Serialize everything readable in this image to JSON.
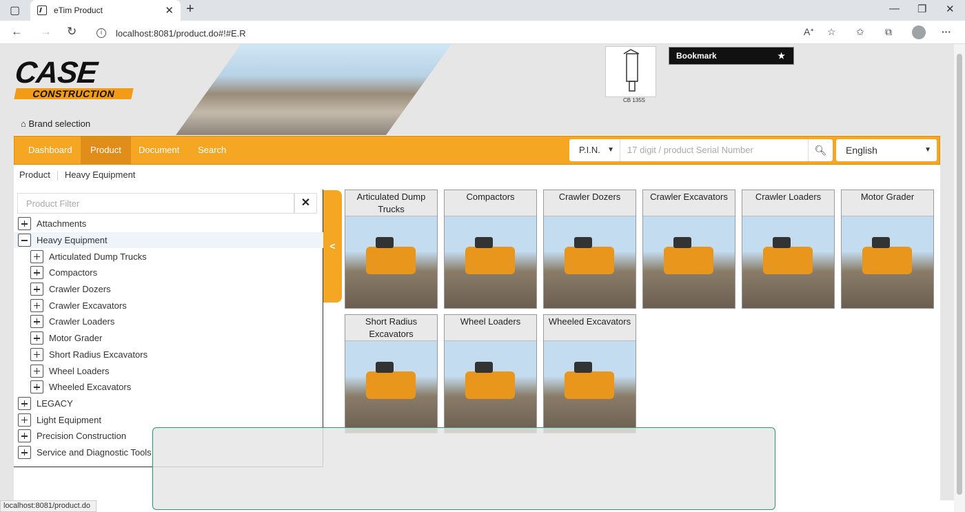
{
  "browser": {
    "tab_title": "eTim Product",
    "tab_close": "✕",
    "new_tab": "+",
    "url": "localhost:8081/product.do#!#E.R",
    "status_url": "localhost:8081/product.do",
    "icons": [
      "sidebar-toggle-icon",
      "back-icon",
      "forward-icon",
      "refresh-icon",
      "info-icon",
      "read-aloud-icon",
      "favorite-add-icon",
      "favorites-icon",
      "collections-icon",
      "profile-icon",
      "more-icon"
    ]
  },
  "header": {
    "brand_case": "CASE",
    "brand_construction": "CONSTRUCTION",
    "brand_selection": "Brand selection",
    "thumb_caption": "CB 135S",
    "bookmark": "Bookmark"
  },
  "nav": {
    "items": [
      "Dashboard",
      "Product",
      "Document",
      "Search"
    ],
    "active": "Product",
    "pin_label": "P.I.N.",
    "pin_placeholder": "17 digit / product Serial Number",
    "language": "English"
  },
  "breadcrumb": [
    "Product",
    "Heavy Equipment"
  ],
  "filter": {
    "placeholder": "Product Filter",
    "clear": "✕"
  },
  "tree": [
    {
      "label": "Attachments",
      "level": 0,
      "expanded": false
    },
    {
      "label": "Heavy Equipment",
      "level": 0,
      "expanded": true,
      "selected": true
    },
    {
      "label": "Articulated Dump Trucks",
      "level": 1,
      "expanded": false
    },
    {
      "label": "Compactors",
      "level": 1,
      "expanded": false
    },
    {
      "label": "Crawler Dozers",
      "level": 1,
      "expanded": false
    },
    {
      "label": "Crawler Excavators",
      "level": 1,
      "expanded": false
    },
    {
      "label": "Crawler Loaders",
      "level": 1,
      "expanded": false
    },
    {
      "label": "Motor Grader",
      "level": 1,
      "expanded": false
    },
    {
      "label": "Short Radius Excavators",
      "level": 1,
      "expanded": false
    },
    {
      "label": "Wheel Loaders",
      "level": 1,
      "expanded": false
    },
    {
      "label": "Wheeled Excavators",
      "level": 1,
      "expanded": false
    },
    {
      "label": "LEGACY",
      "level": 0,
      "expanded": false
    },
    {
      "label": "Light Equipment",
      "level": 0,
      "expanded": false
    },
    {
      "label": "Precision Construction",
      "level": 0,
      "expanded": false
    },
    {
      "label": "Service and Diagnostic Tools",
      "level": 0,
      "expanded": false
    }
  ],
  "cards": [
    "Articulated Dump Trucks",
    "Compactors",
    "Crawler Dozers",
    "Crawler Excavators",
    "Crawler Loaders",
    "Motor Grader",
    "Short Radius Excavators",
    "Wheel Loaders",
    "Wheeled Excavators"
  ],
  "colors": {
    "accent": "#f5a623",
    "accent_dark": "#e08d1a",
    "overlay_border": "#2a9a6a"
  }
}
